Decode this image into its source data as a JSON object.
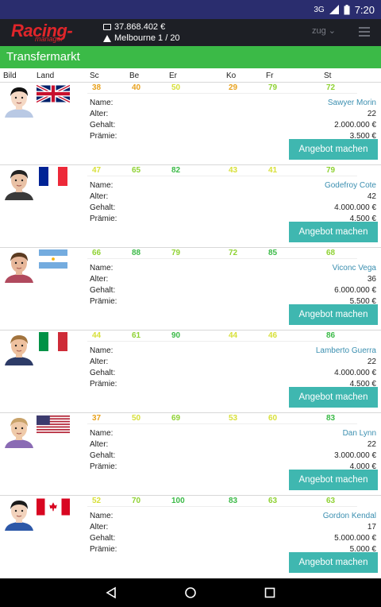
{
  "status": {
    "signal": "3G",
    "time": "7:20"
  },
  "appbar": {
    "logo_main": "Racing-",
    "logo_sub": "manager",
    "balance": "37.868.402 €",
    "race": "Melbourne 1 / 20",
    "zug_label": "zug"
  },
  "header": {
    "title": "Transfermarkt"
  },
  "columns": {
    "bild": "Bild",
    "land": "Land",
    "sc": "Sc",
    "be": "Be",
    "er": "Er",
    "ko": "Ko",
    "fr": "Fr",
    "st": "St"
  },
  "labels": {
    "name": "Name:",
    "alter": "Alter:",
    "gehalt": "Gehalt:",
    "praemie": "Prämie:"
  },
  "button_label": "Angebot machen",
  "stat_colors": {
    "orange": "#e8a21e",
    "lime": "#8fd233",
    "yellow": "#d8e03a",
    "green": "#3bba47"
  },
  "drivers": [
    {
      "flag": "uk",
      "sc": "38",
      "be": "40",
      "er": "50",
      "ko": "29",
      "fr": "79",
      "st": "72",
      "c": [
        "orange",
        "orange",
        "yellow",
        "orange",
        "lime",
        "lime"
      ],
      "name": "Sawyer Morin",
      "alter": "22",
      "gehalt": "2.000.000 €",
      "praemie": "3.500 €",
      "skin": "#f5d8c4",
      "hair": "#111111",
      "shirt": "#b9c9e4"
    },
    {
      "flag": "fr",
      "sc": "47",
      "be": "65",
      "er": "82",
      "ko": "43",
      "fr": "41",
      "st": "79",
      "c": [
        "yellow",
        "lime",
        "green",
        "yellow",
        "yellow",
        "lime"
      ],
      "name": "Godefroy Cote",
      "alter": "42",
      "gehalt": "4.000.000 €",
      "praemie": "4.500 €",
      "skin": "#e9c2a6",
      "hair": "#222222",
      "shirt": "#3a3a3a"
    },
    {
      "flag": "ar",
      "sc": "66",
      "be": "88",
      "er": "79",
      "ko": "72",
      "fr": "85",
      "st": "68",
      "c": [
        "lime",
        "green",
        "lime",
        "lime",
        "green",
        "lime"
      ],
      "name": "Viconc Vega",
      "alter": "36",
      "gehalt": "6.000.000 €",
      "praemie": "5.500 €",
      "skin": "#e7b79a",
      "hair": "#5a3a20",
      "shirt": "#b14a5e"
    },
    {
      "flag": "it",
      "sc": "44",
      "be": "61",
      "er": "90",
      "ko": "44",
      "fr": "46",
      "st": "86",
      "c": [
        "yellow",
        "lime",
        "green",
        "yellow",
        "yellow",
        "green"
      ],
      "name": "Lamberto Guerra",
      "alter": "22",
      "gehalt": "4.000.000 €",
      "praemie": "4.500 €",
      "skin": "#eec19f",
      "hair": "#a2743e",
      "shirt": "#2d3b67"
    },
    {
      "flag": "us",
      "sc": "37",
      "be": "50",
      "er": "69",
      "ko": "53",
      "fr": "60",
      "st": "83",
      "c": [
        "orange",
        "yellow",
        "lime",
        "yellow",
        "yellow",
        "green"
      ],
      "name": "Dan Lynn",
      "alter": "22",
      "gehalt": "3.000.000 €",
      "praemie": "4.000 €",
      "skin": "#efcaa9",
      "hair": "#c9a36a",
      "shirt": "#8a6bb4"
    },
    {
      "flag": "ca",
      "sc": "52",
      "be": "70",
      "er": "100",
      "ko": "83",
      "fr": "63",
      "st": "63",
      "c": [
        "yellow",
        "lime",
        "green",
        "green",
        "lime",
        "lime"
      ],
      "name": "Gordon Kendal",
      "alter": "17",
      "gehalt": "5.000.000 €",
      "praemie": "5.000 €",
      "skin": "#f2d3bd",
      "hair": "#1a1a1a",
      "shirt": "#2d58a8"
    }
  ],
  "nav": {
    "back": "back-icon",
    "home": "home-icon",
    "recent": "recent-icon"
  }
}
